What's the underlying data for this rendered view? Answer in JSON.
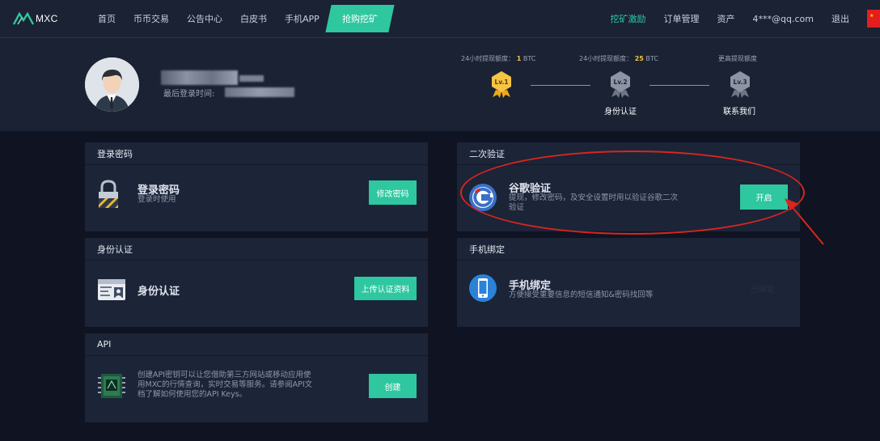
{
  "nav": {
    "logo_text": "MXC",
    "links": [
      "首页",
      "币币交易",
      "公告中心",
      "白皮书",
      "手机APP"
    ],
    "mine_label": "抢购挖矿",
    "right_links": [
      "挖矿激励",
      "订单管理",
      "资产",
      "4***@qq.com",
      "退出"
    ],
    "accent_color": "#2ec7a0"
  },
  "profile": {
    "last_login_label": "最后登录时间:",
    "limits": [
      {
        "label": "24小时提现额度：",
        "value": "1",
        "unit": "BTC"
      },
      {
        "label": "24小时提现额度：",
        "value": "25",
        "unit": "BTC"
      },
      {
        "label": "更高提现额度",
        "value": "",
        "unit": ""
      }
    ],
    "levels": [
      {
        "badge": "Lv.1",
        "caption": ""
      },
      {
        "badge": "Lv.2",
        "caption": "身份认证"
      },
      {
        "badge": "Lv.3",
        "caption": "联系我们"
      }
    ]
  },
  "cards": {
    "login_password": {
      "header": "登录密码",
      "title": "登录密码",
      "subtitle": "登录时使用",
      "button": "修改密码"
    },
    "two_factor": {
      "header": "二次验证",
      "title": "谷歌验证",
      "subtitle_line1": "提现，修改密码，及安全设置时用以验证谷歌二次",
      "subtitle_line2": "验证",
      "button": "开启"
    },
    "identity": {
      "header": "身份认证",
      "title": "身份认证",
      "button": "上传认证资料"
    },
    "phone": {
      "header": "手机绑定",
      "title": "手机绑定",
      "subtitle": "方便接受重要信息的短信通知&密码找回等",
      "status": "已绑定"
    },
    "api": {
      "header": "API",
      "line1": "创建API密钥可以让您借助第三方网站或移动应用使",
      "line2": "用MXC的行情查询，实时交易等服务。请参阅API文",
      "line3": "档了解如何使用您的API Keys。",
      "button": "创建"
    }
  }
}
